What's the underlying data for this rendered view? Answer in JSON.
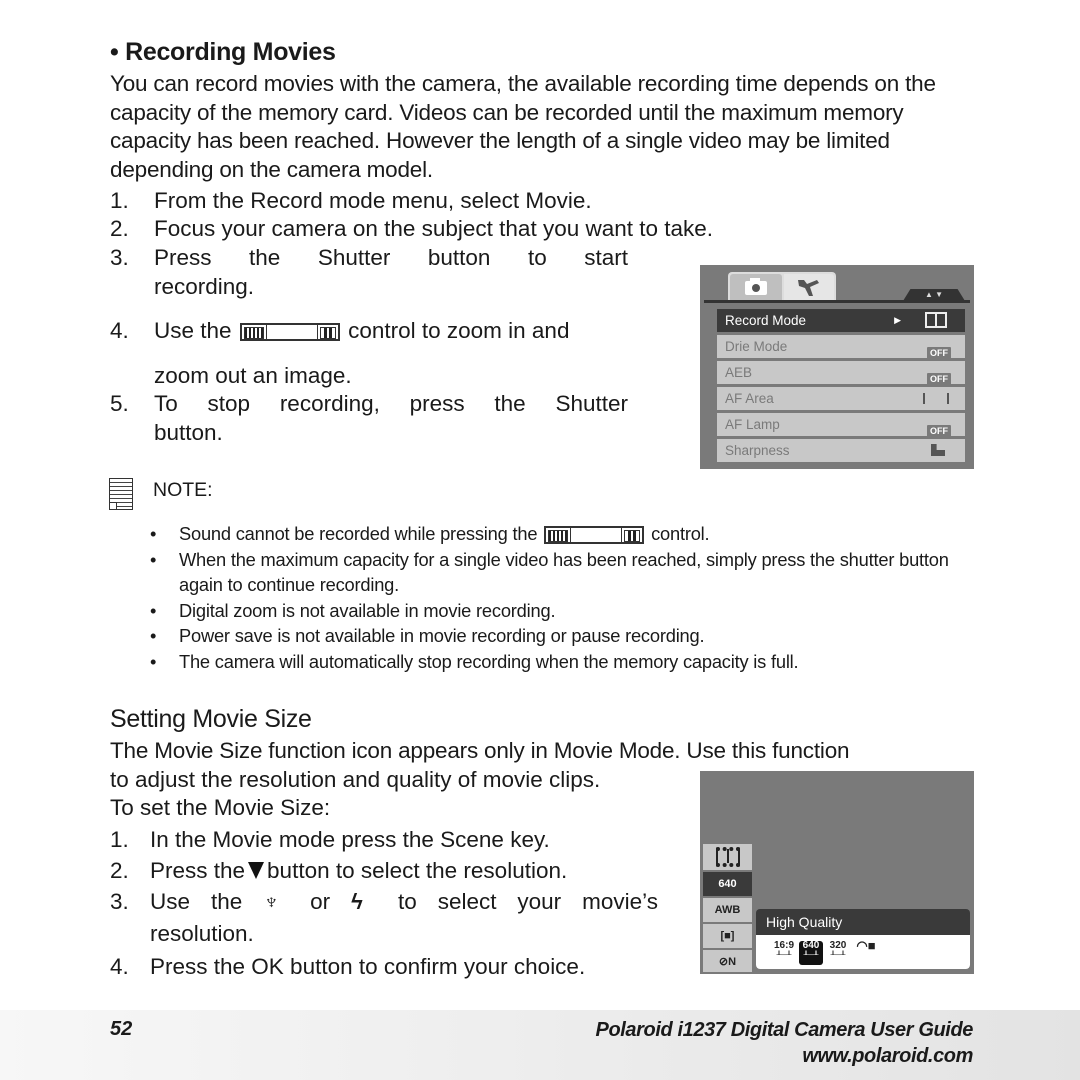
{
  "section1": {
    "heading": "• Recording Movies",
    "intro": "You can record movies with the camera, the available recording time depends on the capacity of the memory card. Videos can be recorded until the maximum memory capacity has been reached. However the length of a single video may be limited depending on the camera model.",
    "steps": [
      {
        "num": "1.",
        "text": "From the Record mode menu, select Movie."
      },
      {
        "num": "2.",
        "text": "Focus your camera on the subject that you want to take."
      },
      {
        "num": "3.",
        "text_a": "Press the Shutter button to start",
        "text_b": "recording."
      },
      {
        "num": "4.",
        "text_pre": "Use the",
        "text_post": "control to zoom in and",
        "text_b": "zoom out an image."
      },
      {
        "num": "5.",
        "text_a": "To stop recording, press the Shutter",
        "text_b": "button."
      }
    ]
  },
  "menu_screen": {
    "tabs": [
      {
        "icon": "camera-icon"
      },
      {
        "icon": "tools-icon"
      }
    ],
    "nav_arrows": "▲ ▼",
    "rows": [
      {
        "label": "Record Mode",
        "value_icon": "movie-film-icon",
        "selected": true
      },
      {
        "label": "Drie Mode",
        "value": "OFF"
      },
      {
        "label": "AEB",
        "value": "OFF"
      },
      {
        "label": "AF Area",
        "value_icon": "af-area-icon"
      },
      {
        "label": "AF Lamp",
        "value": "OFF"
      },
      {
        "label": "Sharpness",
        "value_icon": "sharpness-icon"
      }
    ]
  },
  "note": {
    "label": "NOTE:",
    "bullets": [
      {
        "pre": "Sound cannot be recorded while pressing the",
        "post": "control."
      },
      {
        "text": "When the maximum capacity for a single video has been reached, simply press the shutter button again to continue recording."
      },
      {
        "text": "Digital zoom is not available in movie recording."
      },
      {
        "text": "Power save is not available in movie recording or pause recording."
      },
      {
        "text": "The camera will automatically stop recording when the memory capacity is full."
      }
    ]
  },
  "section2": {
    "heading": "Setting Movie Size",
    "intro_a": "The Movie Size function icon appears only in Movie Mode. Use this function",
    "intro_b": "to adjust the resolution and quality of movie clips.",
    "intro_c": "To set the Movie Size:",
    "steps": [
      {
        "num": "1.",
        "text": "In the Movie mode press the Scene key."
      },
      {
        "num": "2.",
        "text_pre": "Press the",
        "text_post": "button to select the resolution."
      },
      {
        "num": "3.",
        "text_pre": "Use the",
        "text_or": "or",
        "text_post": "to select your movie’s",
        "text_b": "resolution."
      },
      {
        "num": "4.",
        "text": "Press the OK button to confirm your choice."
      }
    ]
  },
  "movie_screen": {
    "side_items": [
      {
        "icon": "movie-film-icon",
        "label": ""
      },
      {
        "label": "640",
        "selected": true
      },
      {
        "label": "AWB"
      },
      {
        "label": "[■]"
      },
      {
        "icon": "color-effect-icon",
        "label": "⊘N"
      }
    ],
    "quality_title": "High Quality",
    "options": [
      {
        "label": "16:9"
      },
      {
        "label": "640",
        "selected": true
      },
      {
        "label": "320"
      },
      {
        "label": "web",
        "icon": "web-video-icon"
      }
    ]
  },
  "footer": {
    "page_number": "52",
    "title": "Polaroid i1237 Digital Camera User Guide",
    "url": "www.polaroid.com"
  }
}
